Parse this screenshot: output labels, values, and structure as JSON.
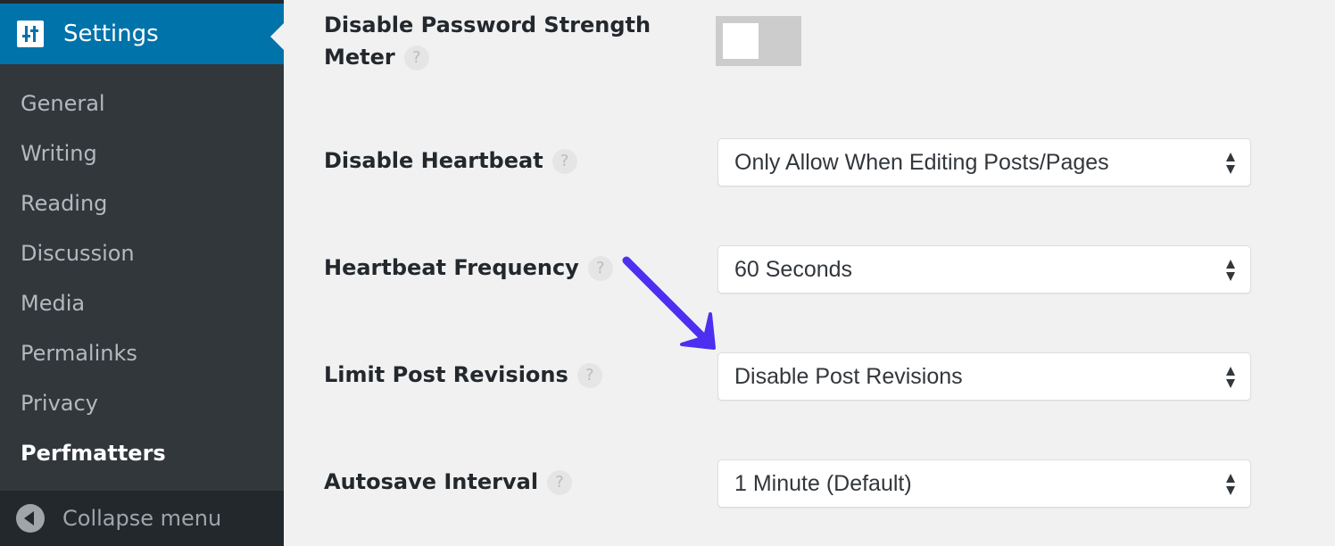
{
  "sidebar": {
    "parent": {
      "label": "Settings",
      "icon": "settings-sliders-icon"
    },
    "items": [
      {
        "label": "General",
        "current": false
      },
      {
        "label": "Writing",
        "current": false
      },
      {
        "label": "Reading",
        "current": false
      },
      {
        "label": "Discussion",
        "current": false
      },
      {
        "label": "Media",
        "current": false
      },
      {
        "label": "Permalinks",
        "current": false
      },
      {
        "label": "Privacy",
        "current": false
      },
      {
        "label": "Perfmatters",
        "current": true
      }
    ],
    "collapse": {
      "label": "Collapse menu",
      "icon": "collapse-arrow-icon"
    }
  },
  "settings": {
    "password_meter": {
      "label_line1": "Disable Password Strength",
      "label_line2": "Meter",
      "help": "?",
      "enabled": false
    },
    "heartbeat": {
      "label": "Disable Heartbeat",
      "help": "?",
      "value": "Only Allow When Editing Posts/Pages"
    },
    "heartbeat_frequency": {
      "label": "Heartbeat Frequency",
      "help": "?",
      "value": "60 Seconds"
    },
    "post_revisions": {
      "label": "Limit Post Revisions",
      "help": "?",
      "value": "Disable Post Revisions"
    },
    "autosave": {
      "label": "Autosave Interval",
      "help": "?",
      "value": "1 Minute (Default)"
    }
  },
  "annotation": {
    "type": "arrow",
    "color": "#4c2ff0",
    "points_to": "post_revisions"
  },
  "colors": {
    "sidebar_bg": "#32373c",
    "accent": "#0073aa",
    "content_bg": "#f1f1f1"
  }
}
